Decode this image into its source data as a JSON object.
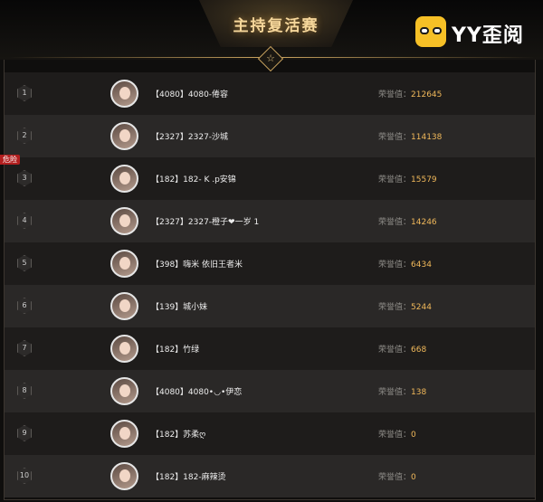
{
  "banner": {
    "title": "主持复活赛"
  },
  "logo": {
    "text": "YY歪阅"
  },
  "colors": {
    "gold": "#c9a25e",
    "honor_value": "#f0b85a",
    "danger": "#b21f1f"
  },
  "danger_tag": "危险",
  "honor_label": "荣誉值：",
  "rows": [
    {
      "rank": "1",
      "name": "【4080】4080-倦容",
      "honor": "212645"
    },
    {
      "rank": "2",
      "name": "【2327】2327-沙城",
      "honor": "114138"
    },
    {
      "rank": "3",
      "name": "【182】182- K .p安锦",
      "honor": "15579"
    },
    {
      "rank": "4",
      "name": "【2327】2327-橙子❤一岁 1",
      "honor": "14246"
    },
    {
      "rank": "5",
      "name": "【398】嗨米 依旧王者米",
      "honor": "6434"
    },
    {
      "rank": "6",
      "name": "【139】城小妹",
      "honor": "5244"
    },
    {
      "rank": "7",
      "name": "【182】竹绿",
      "honor": "668"
    },
    {
      "rank": "8",
      "name": "【4080】4080•◡•伊恋",
      "honor": "138"
    },
    {
      "rank": "9",
      "name": "【182】苏柔ღ",
      "honor": "0"
    },
    {
      "rank": "10",
      "name": "【182】182-麻辣烫",
      "honor": "0"
    }
  ]
}
